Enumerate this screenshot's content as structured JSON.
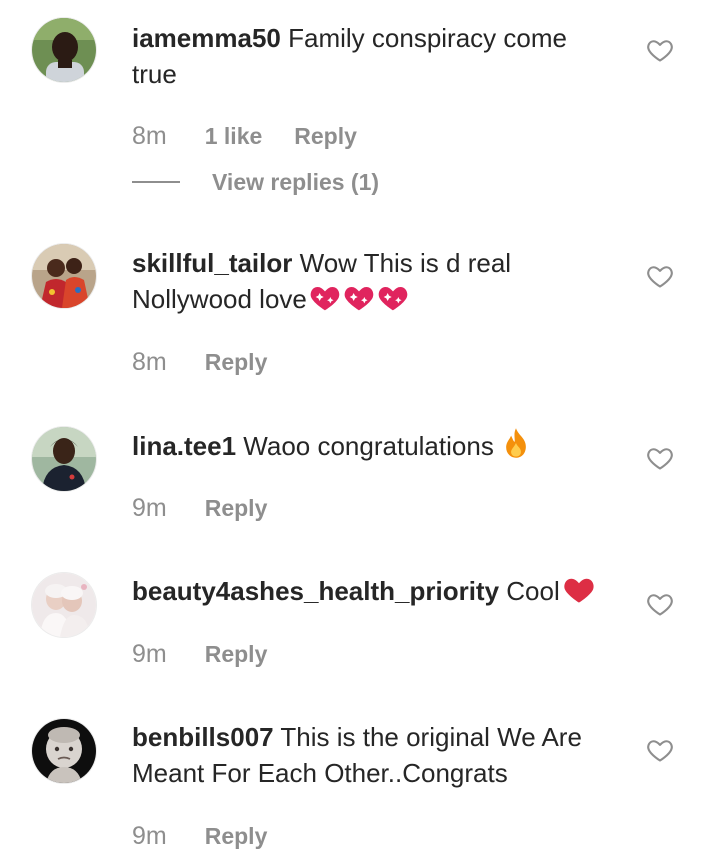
{
  "comments": [
    {
      "username": "iamemma50",
      "text": "Family conspiracy come true",
      "time": "8m",
      "likes": "1 like",
      "reply_label": "Reply",
      "view_replies": "View replies (1)",
      "avatar": "avatar-man-green-background"
    },
    {
      "username": "skillful_tailor",
      "text": "Wow This is d real Nollywood love",
      "emoji": "sparkling-heart-x3",
      "time": "8m",
      "reply_label": "Reply",
      "avatar": "avatar-couple-red-outfit"
    },
    {
      "username": "lina.tee1",
      "text": "Waoo congratulations",
      "emoji": "fire",
      "time": "9m",
      "reply_label": "Reply",
      "avatar": "avatar-woman-dark-dress"
    },
    {
      "username": "beauty4ashes_health_priority",
      "text": "Cool",
      "emoji": "red-heart",
      "time": "9m",
      "reply_label": "Reply",
      "avatar": "avatar-babies-white"
    },
    {
      "username": "benbills007",
      "text": "This is the original We Are Meant For Each Other..Congrats",
      "time": "9m",
      "reply_label": "Reply",
      "avatar": "avatar-baby-dark-background"
    }
  ],
  "colors": {
    "text": "#262626",
    "meta": "#8e8e8e",
    "heart_outline": "#8e8e8e",
    "emoji_heart": "#e0245e"
  },
  "icons": {
    "like": "heart-outline-icon"
  }
}
